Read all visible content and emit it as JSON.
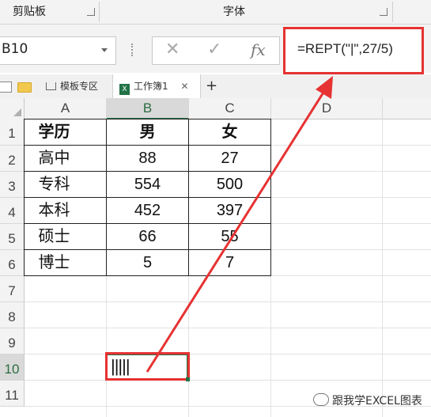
{
  "ribbon": {
    "clipboard_label": "剪贴板",
    "font_label": "字体"
  },
  "formula_bar": {
    "name_box": "B10",
    "cancel_icon": "✕",
    "enter_icon": "✓",
    "fx_label": "fx",
    "formula": "=REPT(\"|\",27/5)"
  },
  "tabs": {
    "template_tab": "模板专区",
    "workbook_tab": "工作簿1",
    "add_label": "+"
  },
  "columns": [
    "A",
    "B",
    "C",
    "D"
  ],
  "rows": [
    "1",
    "2",
    "3",
    "4",
    "5",
    "6",
    "7",
    "8",
    "9",
    "10",
    "11"
  ],
  "table": {
    "headers": [
      "学历",
      "男",
      "女"
    ],
    "data": [
      [
        "高中",
        "88",
        "27"
      ],
      [
        "专科",
        "554",
        "500"
      ],
      [
        "本科",
        "452",
        "397"
      ],
      [
        "硕士",
        "66",
        "55"
      ],
      [
        "博士",
        "5",
        "7"
      ]
    ]
  },
  "selected_cell": {
    "value": "|||||"
  },
  "accent_colors": {
    "annotation_red": "#e63232",
    "excel_green": "#217346"
  },
  "watermark": "跟我学EXCEL图表"
}
